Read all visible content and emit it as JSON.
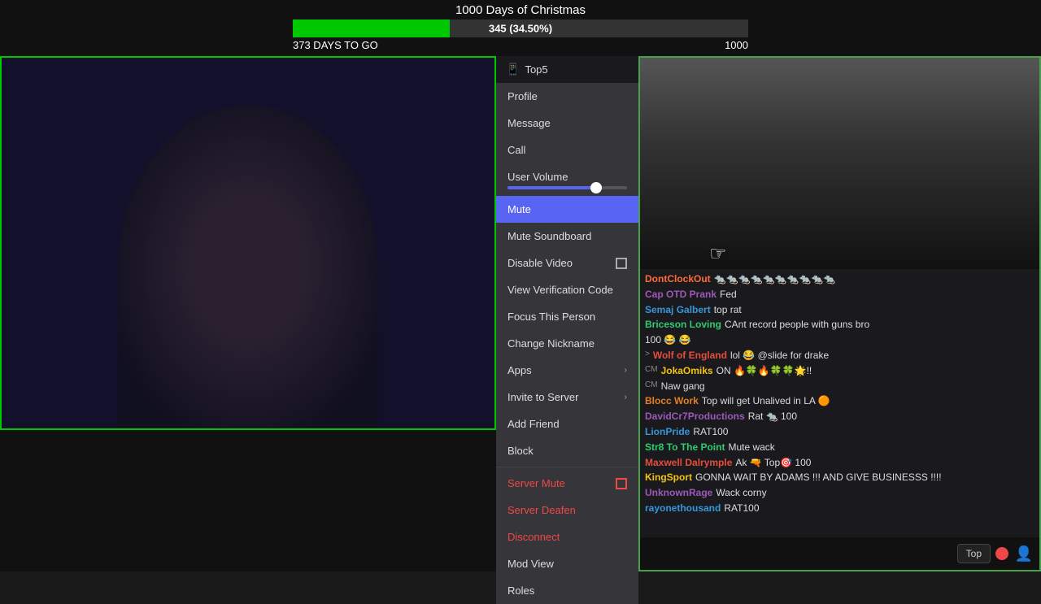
{
  "banner": {
    "title": "1000 Days of Christmas",
    "progress_value": "345 (34.50%)",
    "days_left_label": "373 DAYS TO GO",
    "total": "1000",
    "progress_percent": 34.5
  },
  "bottom_bar": {
    "mobile_icon": "📱",
    "top5_label": "Top5"
  },
  "context_menu": {
    "items": [
      {
        "id": "profile",
        "label": "Profile",
        "type": "normal"
      },
      {
        "id": "message",
        "label": "Message",
        "type": "normal"
      },
      {
        "id": "call",
        "label": "Call",
        "type": "normal"
      },
      {
        "id": "user-volume",
        "label": "User Volume",
        "type": "volume"
      },
      {
        "id": "mute",
        "label": "Mute",
        "type": "active",
        "checkbox": true,
        "checked": true
      },
      {
        "id": "mute-soundboard",
        "label": "Mute Soundboard",
        "type": "normal"
      },
      {
        "id": "disable-video",
        "label": "Disable Video",
        "type": "checkbox",
        "checked": false
      },
      {
        "id": "view-verification-code",
        "label": "View Verification Code",
        "type": "normal"
      },
      {
        "id": "focus-this-person",
        "label": "Focus This Person",
        "type": "normal"
      },
      {
        "id": "change-nickname",
        "label": "Change Nickname",
        "type": "normal"
      },
      {
        "id": "apps",
        "label": "Apps",
        "type": "submenu"
      },
      {
        "id": "invite-to-server",
        "label": "Invite to Server",
        "type": "submenu"
      },
      {
        "id": "add-friend",
        "label": "Add Friend",
        "type": "normal"
      },
      {
        "id": "block",
        "label": "Block",
        "type": "normal"
      }
    ],
    "server_items": [
      {
        "id": "server-mute",
        "label": "Server Mute",
        "type": "danger",
        "checkbox": true
      },
      {
        "id": "server-deafen",
        "label": "Server Deafen",
        "type": "danger"
      },
      {
        "id": "disconnect",
        "label": "Disconnect",
        "type": "danger"
      },
      {
        "id": "mod-view",
        "label": "Mod View",
        "type": "normal"
      },
      {
        "id": "roles",
        "label": "Roles",
        "type": "normal"
      }
    ]
  },
  "chat": {
    "messages": [
      {
        "username": "DontClockOut",
        "username_color": "#ff6b35",
        "text": "🐀🐀🐀🐀🐀🐀🐀🐀🐀🐀",
        "badges": ""
      },
      {
        "username": "Cap OTD Prank",
        "username_color": "#9b59b6",
        "text": "Fed",
        "badges": ""
      },
      {
        "username": "Semaj Galbert",
        "username_color": "#3498db",
        "text": "top rat",
        "badges": ""
      },
      {
        "username": "Briceson Loving",
        "username_color": "#2ecc71",
        "text": "CAnt record people with guns bro",
        "badges": ""
      },
      {
        "username": "",
        "username_color": "#fff",
        "text": "100 😂 😂",
        "badges": ""
      },
      {
        "username": "Wolf of England",
        "username_color": "#e74c3c",
        "text": "lol 😂 @slide for drake",
        "badges": ">"
      },
      {
        "username": "JokaOmiks",
        "username_color": "#f1c40f",
        "text": "ON 🔥🍀🔥🍀🍀🌟!!",
        "badges": "CM"
      },
      {
        "username": "",
        "username_color": "#fff",
        "text": "Naw gang",
        "badges": "CM"
      },
      {
        "username": "Blocc Work",
        "username_color": "#e67e22",
        "text": "Top will get Unalived in LA 🟠",
        "badges": ""
      },
      {
        "username": "DavidCr7Productions",
        "username_color": "#9b59b6",
        "text": "Rat 🐀 100",
        "badges": ""
      },
      {
        "username": "LionPride",
        "username_color": "#3498db",
        "text": "RAT100",
        "badges": ""
      },
      {
        "username": "Str8 To The Point",
        "username_color": "#2ecc71",
        "text": "Mute wack",
        "badges": ""
      },
      {
        "username": "Maxwell Dalrymple",
        "username_color": "#e74c3c",
        "text": "Ak 🔫 Top🎯 100",
        "badges": ""
      },
      {
        "username": "KingSport",
        "username_color": "#f1c40f",
        "text": "GONNA WAIT BY ADAMS !!! AND GIVE BUSINESSS !!!!",
        "badges": ""
      },
      {
        "username": "UnknownRage",
        "username_color": "#9b59b6",
        "text": "Wack corny",
        "badges": ""
      },
      {
        "username": "rayonethousand",
        "username_color": "#3498db",
        "text": "RAT100",
        "badges": ""
      }
    ]
  },
  "scroll_button": {
    "label": "Top"
  }
}
